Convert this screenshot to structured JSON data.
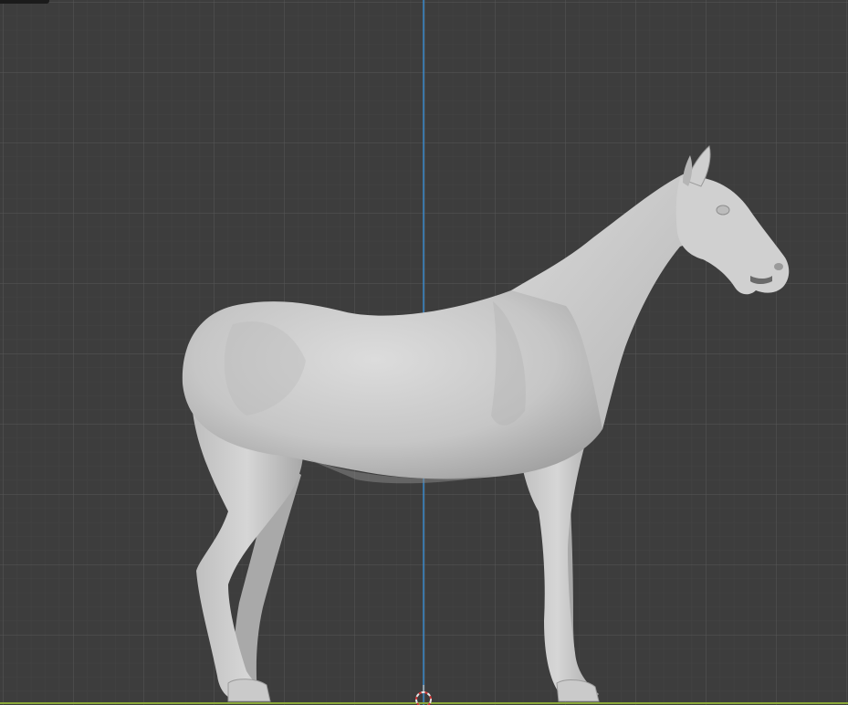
{
  "viewport": {
    "mode": "orthographic-side-view",
    "background_color": "#3d3d3d",
    "grid_minor_color": "#444444",
    "grid_major_color": "#545454",
    "z_axis_color": "#3a8fd6",
    "x_axis_color": "#8aa839",
    "mesh_color": "#c9c9c9",
    "object": "horse-sculpt-mesh",
    "origin_marker_icon": "3d-cursor-icon"
  }
}
